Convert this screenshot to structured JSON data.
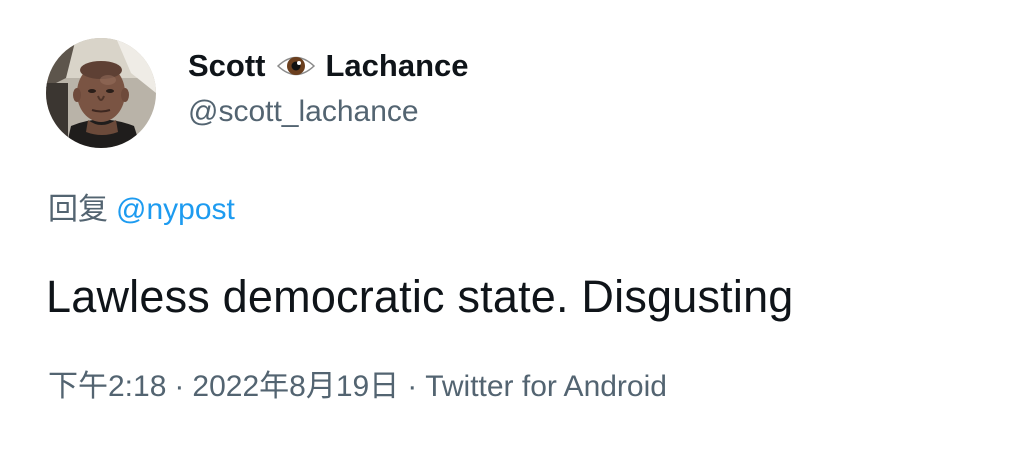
{
  "tweet": {
    "author": {
      "name_first": "Scott",
      "name_emoji": "eye-emoji",
      "name_last": "Lachance",
      "handle": "@scott_lachance"
    },
    "reply": {
      "prefix": "回复",
      "target": "@nypost"
    },
    "text": "Lawless democratic state. Disgusting",
    "meta": {
      "time": "下午2:18",
      "separator": "·",
      "date": "2022年8月19日",
      "source": "Twitter for Android"
    }
  },
  "colors": {
    "text": "#0f1419",
    "secondary": "#536471",
    "link": "#1d9bf0",
    "background": "#ffffff"
  }
}
